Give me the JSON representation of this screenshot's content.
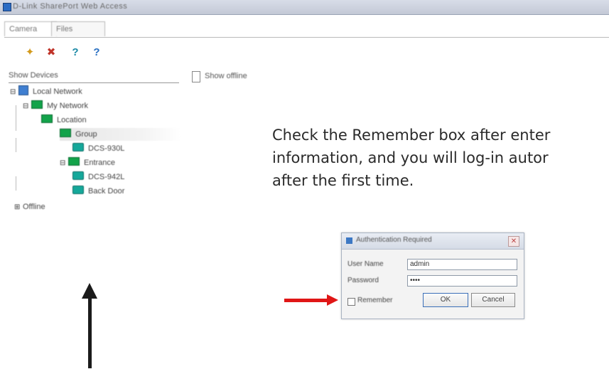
{
  "window": {
    "title": "D-Link SharePort Web Access"
  },
  "tabs": [
    {
      "label": "Camera"
    },
    {
      "label": "Files"
    }
  ],
  "toolbar": {
    "icons": [
      "folder-icon",
      "delete-icon",
      "help-icon",
      "info-icon"
    ]
  },
  "filter": {
    "label": "Show Devices",
    "checkbox_label": "Show offline"
  },
  "tree": {
    "root": "Local Network",
    "items": [
      {
        "label": "My Network",
        "level": 1,
        "kind": "folder"
      },
      {
        "label": "Location",
        "level": 2,
        "kind": "folder"
      },
      {
        "label": "Group",
        "level": 3,
        "kind": "folder"
      },
      {
        "label": "DCS-930L",
        "level": 4,
        "kind": "camera"
      },
      {
        "label": "Entrance",
        "level": 3,
        "kind": "folder"
      },
      {
        "label": "DCS-942L",
        "level": 4,
        "kind": "camera"
      },
      {
        "label": "Back Door",
        "level": 4,
        "kind": "camera"
      }
    ],
    "footer": "Offline"
  },
  "instruction": {
    "text": "Check the Remember box after enter\ninformation, and you will log-in autor\nafter the first time."
  },
  "login_dialog": {
    "title": "Authentication Required",
    "username_label": "User Name",
    "username_value": "admin",
    "password_label": "Password",
    "password_value": "••••",
    "remember_label": "Remember",
    "ok_label": "OK",
    "cancel_label": "Cancel"
  },
  "colors": {
    "arrow_red": "#e01616",
    "arrow_black": "#1b1b1b",
    "folder_green": "#12a34a"
  }
}
